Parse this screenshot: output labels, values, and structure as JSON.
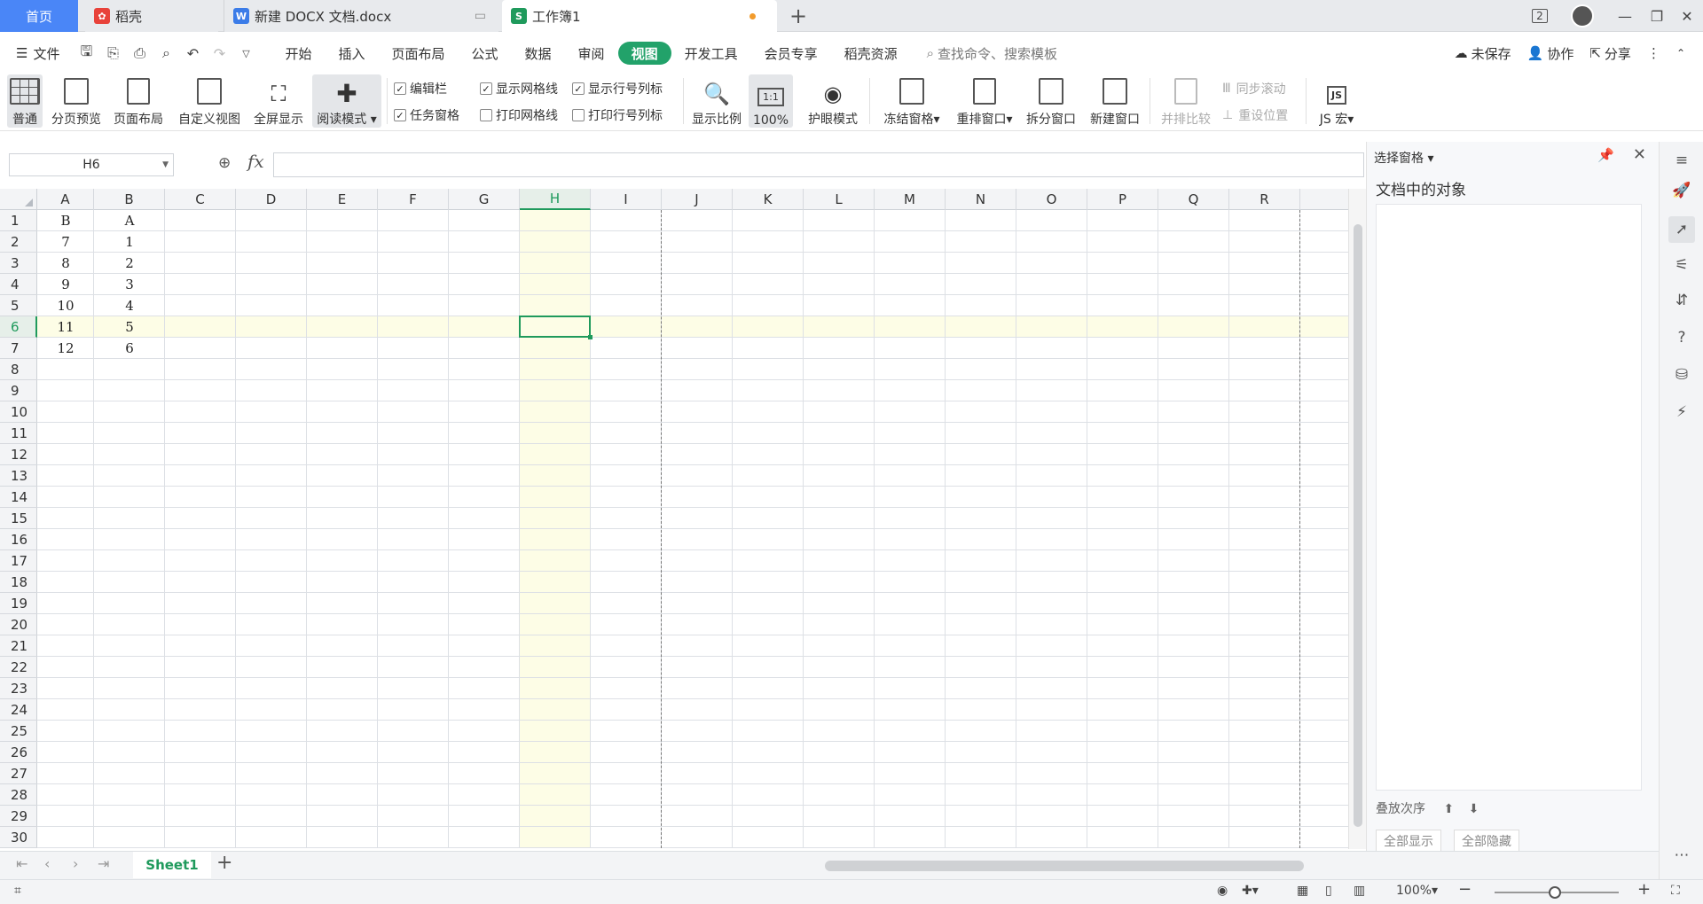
{
  "tabs": {
    "home": "首页",
    "docer": "稻壳",
    "doc": "新建 DOCX 文档.docx",
    "book": "工作簿1",
    "add": "+"
  },
  "window": {
    "badge": "2"
  },
  "menu": {
    "file": "文件",
    "items": [
      "开始",
      "插入",
      "页面布局",
      "公式",
      "数据",
      "审阅",
      "视图",
      "开发工具",
      "会员专享",
      "稻壳资源"
    ],
    "search": "查找命令、搜索模板",
    "unsaved": "未保存",
    "collab": "协作",
    "share": "分享"
  },
  "ribbon": {
    "normal": "普通",
    "page_preview": "分页预览",
    "page_layout": "页面布局",
    "custom_view": "自定义视图",
    "fullscreen": "全屏显示",
    "read_mode": "阅读模式",
    "edit_bar": "编辑栏",
    "task_pane": "任务窗格",
    "show_grid": "显示网格线",
    "print_grid": "打印网格线",
    "show_headers": "显示行号列标",
    "print_headers": "打印行号列标",
    "zoom": "显示比例",
    "zoom100": "100%",
    "zoom100_icon": "1:1",
    "eye_mode": "护眼模式",
    "freeze": "冻结窗格",
    "arrange": "重排窗口",
    "split": "拆分窗口",
    "new_window": "新建窗口",
    "compare": "并排比较",
    "sync_scroll": "同步滚动",
    "reset_pos": "重设位置",
    "js_macro": "JS 宏",
    "js_icon": "JS"
  },
  "formula_bar": {
    "name_box": "H6",
    "fx": "fx",
    "value": ""
  },
  "grid": {
    "columns": [
      "A",
      "B",
      "C",
      "D",
      "E",
      "F",
      "G",
      "H",
      "I",
      "J",
      "K",
      "L",
      "M",
      "N",
      "O",
      "P",
      "Q",
      "R"
    ],
    "rows": [
      "1",
      "2",
      "3",
      "4",
      "5",
      "6",
      "7",
      "8",
      "9",
      "10",
      "11",
      "12",
      "13",
      "14",
      "15",
      "16",
      "17",
      "18",
      "19",
      "20",
      "21",
      "22",
      "23",
      "24",
      "25",
      "26",
      "27",
      "28",
      "29",
      "30"
    ],
    "selected_col": "H",
    "selected_row": "6",
    "data": [
      [
        "B",
        "A"
      ],
      [
        "7",
        "1"
      ],
      [
        "8",
        "2"
      ],
      [
        "9",
        "3"
      ],
      [
        "10",
        "4"
      ],
      [
        "11",
        "5"
      ],
      [
        "12",
        "6"
      ]
    ]
  },
  "pane": {
    "title": "选择窗格",
    "subtitle": "文档中的对象",
    "bottom_label": "叠放次序",
    "show_all": "全部显示",
    "hide_all": "全部隐藏"
  },
  "sheets": {
    "active": "Sheet1"
  },
  "status": {
    "zoom": "100%"
  },
  "colors": {
    "accent": "#22a26a",
    "highlight": "#fdfde6",
    "home_tab": "#4a86f7"
  }
}
